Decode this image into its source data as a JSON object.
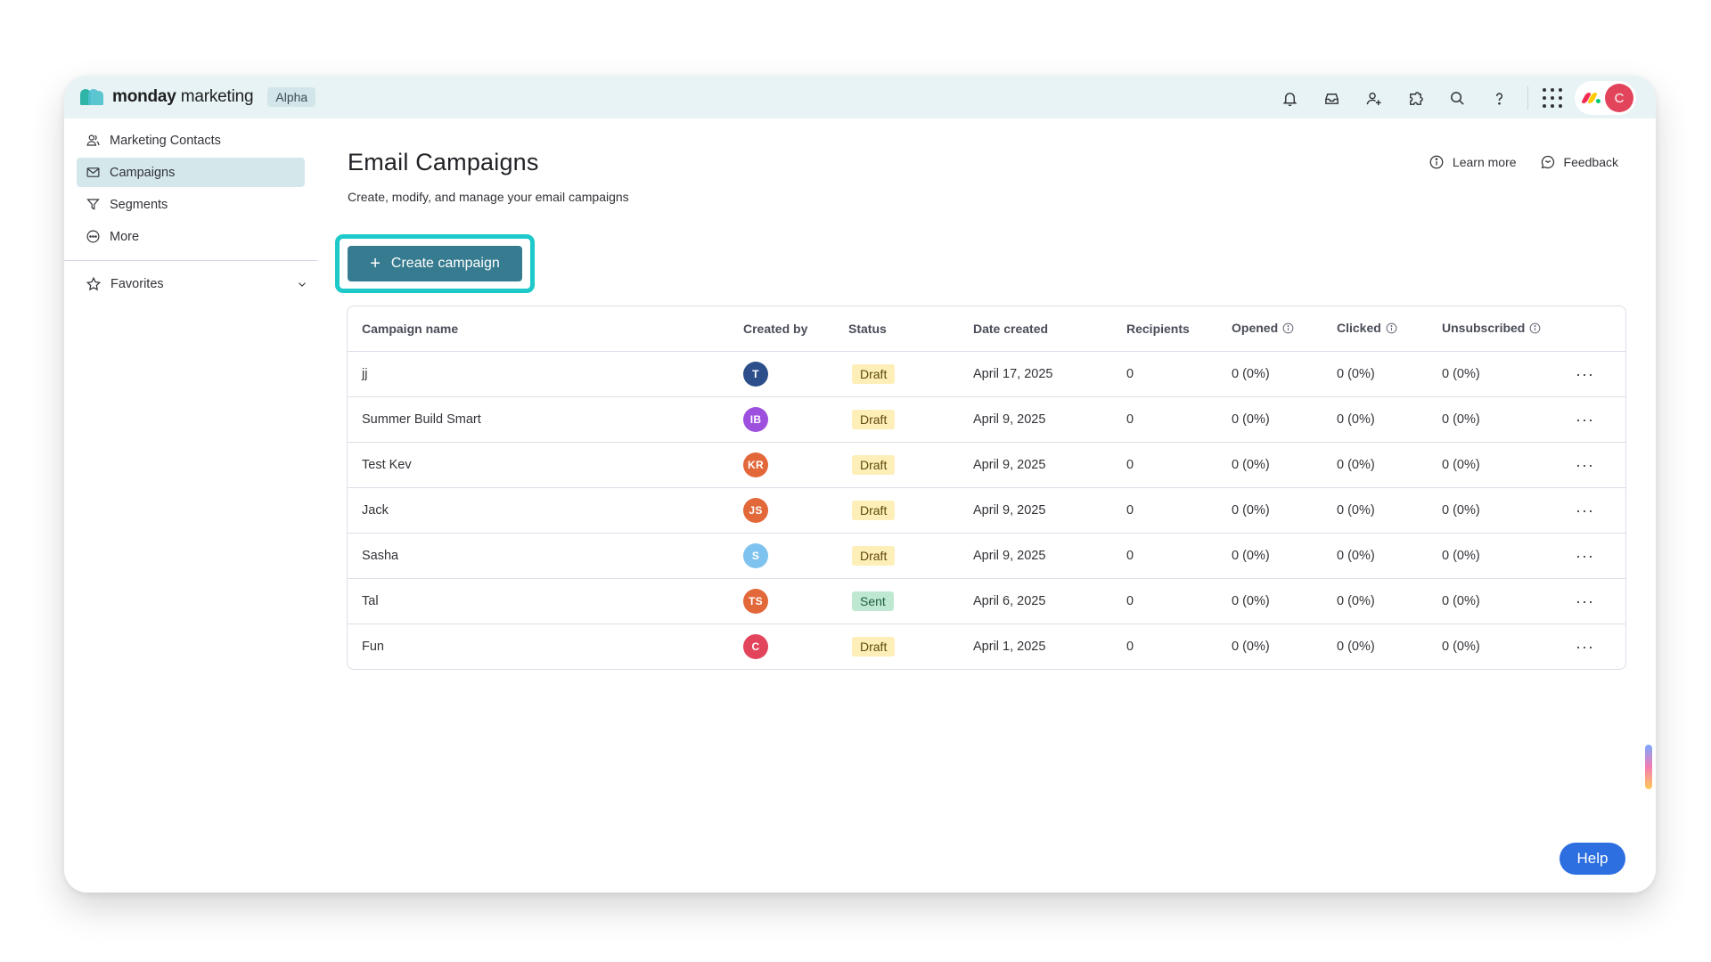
{
  "app": {
    "brand_bold": "monday",
    "brand_rest": "marketing",
    "badge": "Alpha"
  },
  "topbar": {
    "icons": [
      "bell-icon",
      "inbox-icon",
      "invite-user-icon",
      "integrations-icon",
      "search-icon",
      "help-icon",
      "apps-grid-icon"
    ],
    "user_initial": "C",
    "user_color": "#e2445c"
  },
  "sidebar": {
    "items": [
      {
        "label": "Marketing Contacts",
        "icon": "contacts-icon"
      },
      {
        "label": "Campaigns",
        "icon": "mail-icon",
        "active": true
      },
      {
        "label": "Segments",
        "icon": "filter-icon"
      },
      {
        "label": "More",
        "icon": "more-icon"
      }
    ],
    "favorites_label": "Favorites"
  },
  "main": {
    "title": "Email Campaigns",
    "subtitle": "Create, modify, and manage your email campaigns",
    "learn_more": "Learn more",
    "feedback": "Feedback",
    "create_button": "Create campaign",
    "help_button": "Help"
  },
  "table": {
    "headers": [
      "Campaign name",
      "Created by",
      "Status",
      "Date created",
      "Recipients",
      "Opened",
      "Clicked",
      "Unsubscribed"
    ],
    "rows": [
      {
        "name": "jj",
        "initials": "T",
        "avatar_color": "#2c4f8c",
        "status": "Draft",
        "date": "April 17, 2025",
        "recipients": "0",
        "opened": "0 (0%)",
        "clicked": "0 (0%)",
        "unsubscribed": "0 (0%)"
      },
      {
        "name": "Summer Build Smart",
        "initials": "IB",
        "avatar_color": "#9d50dd",
        "status": "Draft",
        "date": "April 9, 2025",
        "recipients": "0",
        "opened": "0 (0%)",
        "clicked": "0 (0%)",
        "unsubscribed": "0 (0%)"
      },
      {
        "name": "Test Kev",
        "initials": "KR",
        "avatar_color": "#e2683a",
        "status": "Draft",
        "date": "April 9, 2025",
        "recipients": "0",
        "opened": "0 (0%)",
        "clicked": "0 (0%)",
        "unsubscribed": "0 (0%)"
      },
      {
        "name": "Jack",
        "initials": "JS",
        "avatar_color": "#e2683a",
        "status": "Draft",
        "date": "April 9, 2025",
        "recipients": "0",
        "opened": "0 (0%)",
        "clicked": "0 (0%)",
        "unsubscribed": "0 (0%)"
      },
      {
        "name": "Sasha",
        "initials": "S",
        "avatar_color": "#7ec2ef",
        "status": "Draft",
        "date": "April 9, 2025",
        "recipients": "0",
        "opened": "0 (0%)",
        "clicked": "0 (0%)",
        "unsubscribed": "0 (0%)"
      },
      {
        "name": "Tal",
        "initials": "TS",
        "avatar_color": "#e2683a",
        "status": "Sent",
        "date": "April 6, 2025",
        "recipients": "0",
        "opened": "0 (0%)",
        "clicked": "0 (0%)",
        "unsubscribed": "0 (0%)"
      },
      {
        "name": "Fun",
        "initials": "C",
        "avatar_color": "#e2445c",
        "status": "Draft",
        "date": "April 1, 2025",
        "recipients": "0",
        "opened": "0 (0%)",
        "clicked": "0 (0%)",
        "unsubscribed": "0 (0%)"
      }
    ]
  },
  "colors": {
    "accent": "#367b8f",
    "highlight": "#1ec9c9",
    "draft_bg": "#fdefb7",
    "sent_bg": "#bfe8d3",
    "help_blue": "#2d6fe0"
  }
}
